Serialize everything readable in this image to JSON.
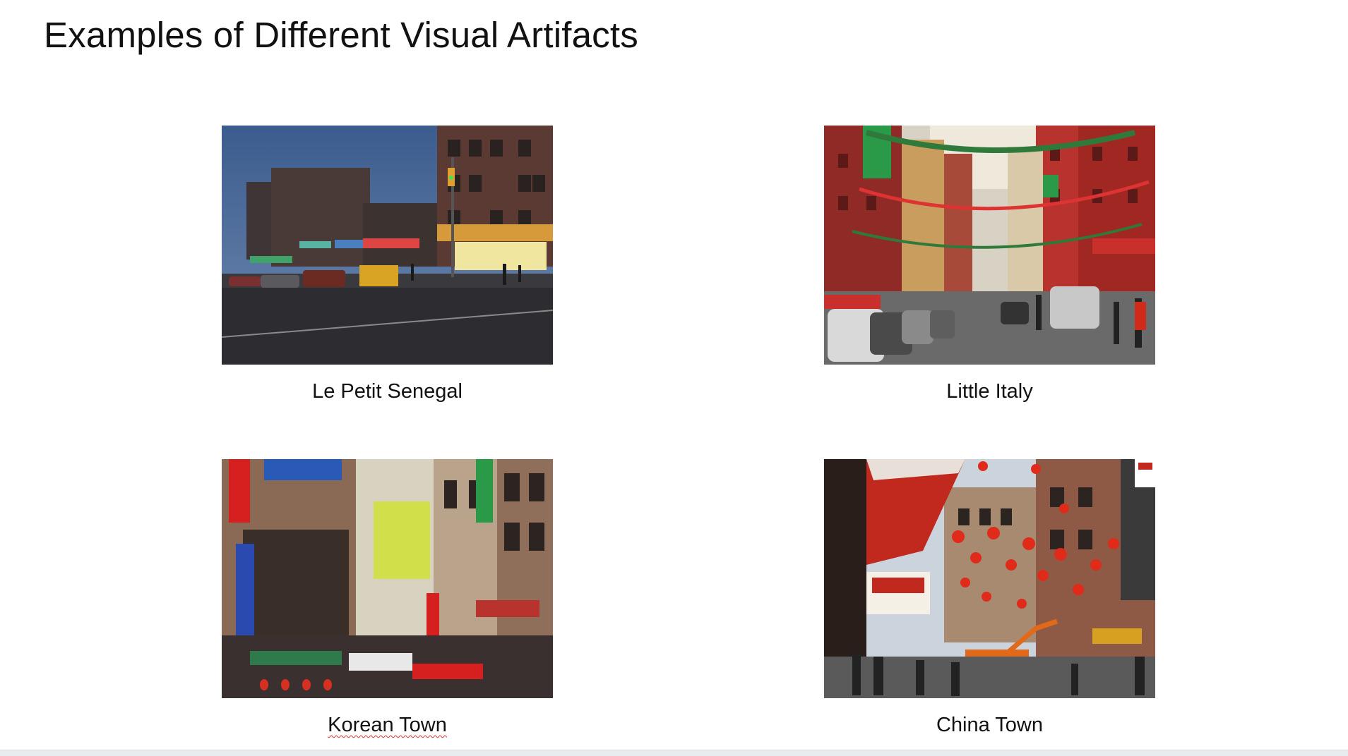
{
  "slide": {
    "title": "Examples of Different Visual Artifacts"
  },
  "photos": [
    {
      "caption": "Le Petit Senegal",
      "icon": "street-photo"
    },
    {
      "caption": "Little Italy",
      "icon": "street-photo"
    },
    {
      "caption": "Korean Town",
      "icon": "street-photo"
    },
    {
      "caption": "China Town",
      "icon": "street-photo"
    }
  ],
  "colors": {
    "background": "#ffffff",
    "text": "#111111",
    "spellcheck_underline": "#d83030"
  }
}
